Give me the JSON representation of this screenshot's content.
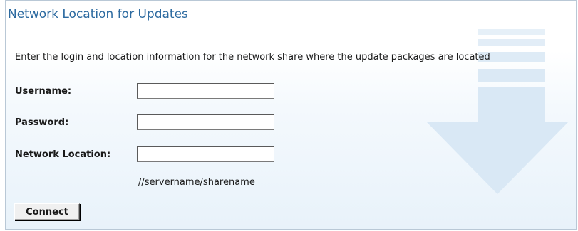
{
  "page": {
    "title": "Network Location for Updates",
    "description": "Enter the login and location information for the network share where the update packages are located"
  },
  "form": {
    "username": {
      "label": "Username:",
      "value": ""
    },
    "password": {
      "label": "Password:",
      "value": ""
    },
    "network_location": {
      "label": "Network Location:",
      "value": "",
      "hint": "//servername/sharename"
    },
    "connect_label": "Connect"
  },
  "colors": {
    "title": "#2c6aa0",
    "background_arrow": "#dbe9f5"
  },
  "icons": {
    "background": "down-arrow-icon"
  }
}
